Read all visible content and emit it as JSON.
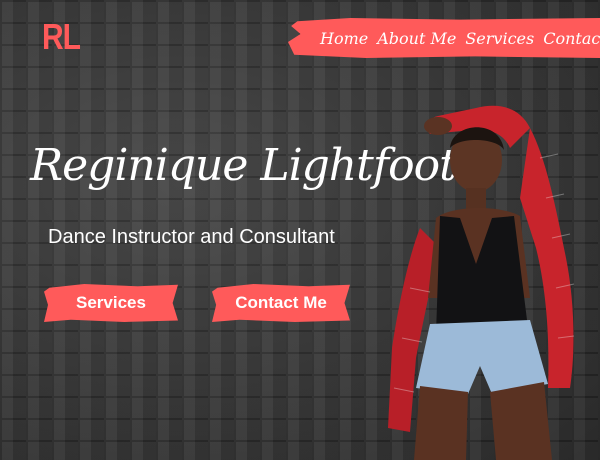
{
  "logo": {
    "text": "RL"
  },
  "nav": {
    "items": [
      "Home",
      "About Me",
      "Services",
      "Contact"
    ]
  },
  "hero": {
    "name": "Reginique Lightfoot",
    "tagline": "Dance Instructor and Consultant"
  },
  "buttons": {
    "services": "Services",
    "contact": "Contact Me"
  },
  "colors": {
    "accent": "#ff5a5a",
    "brick": "#3a3a3a",
    "text": "#ffffff"
  }
}
